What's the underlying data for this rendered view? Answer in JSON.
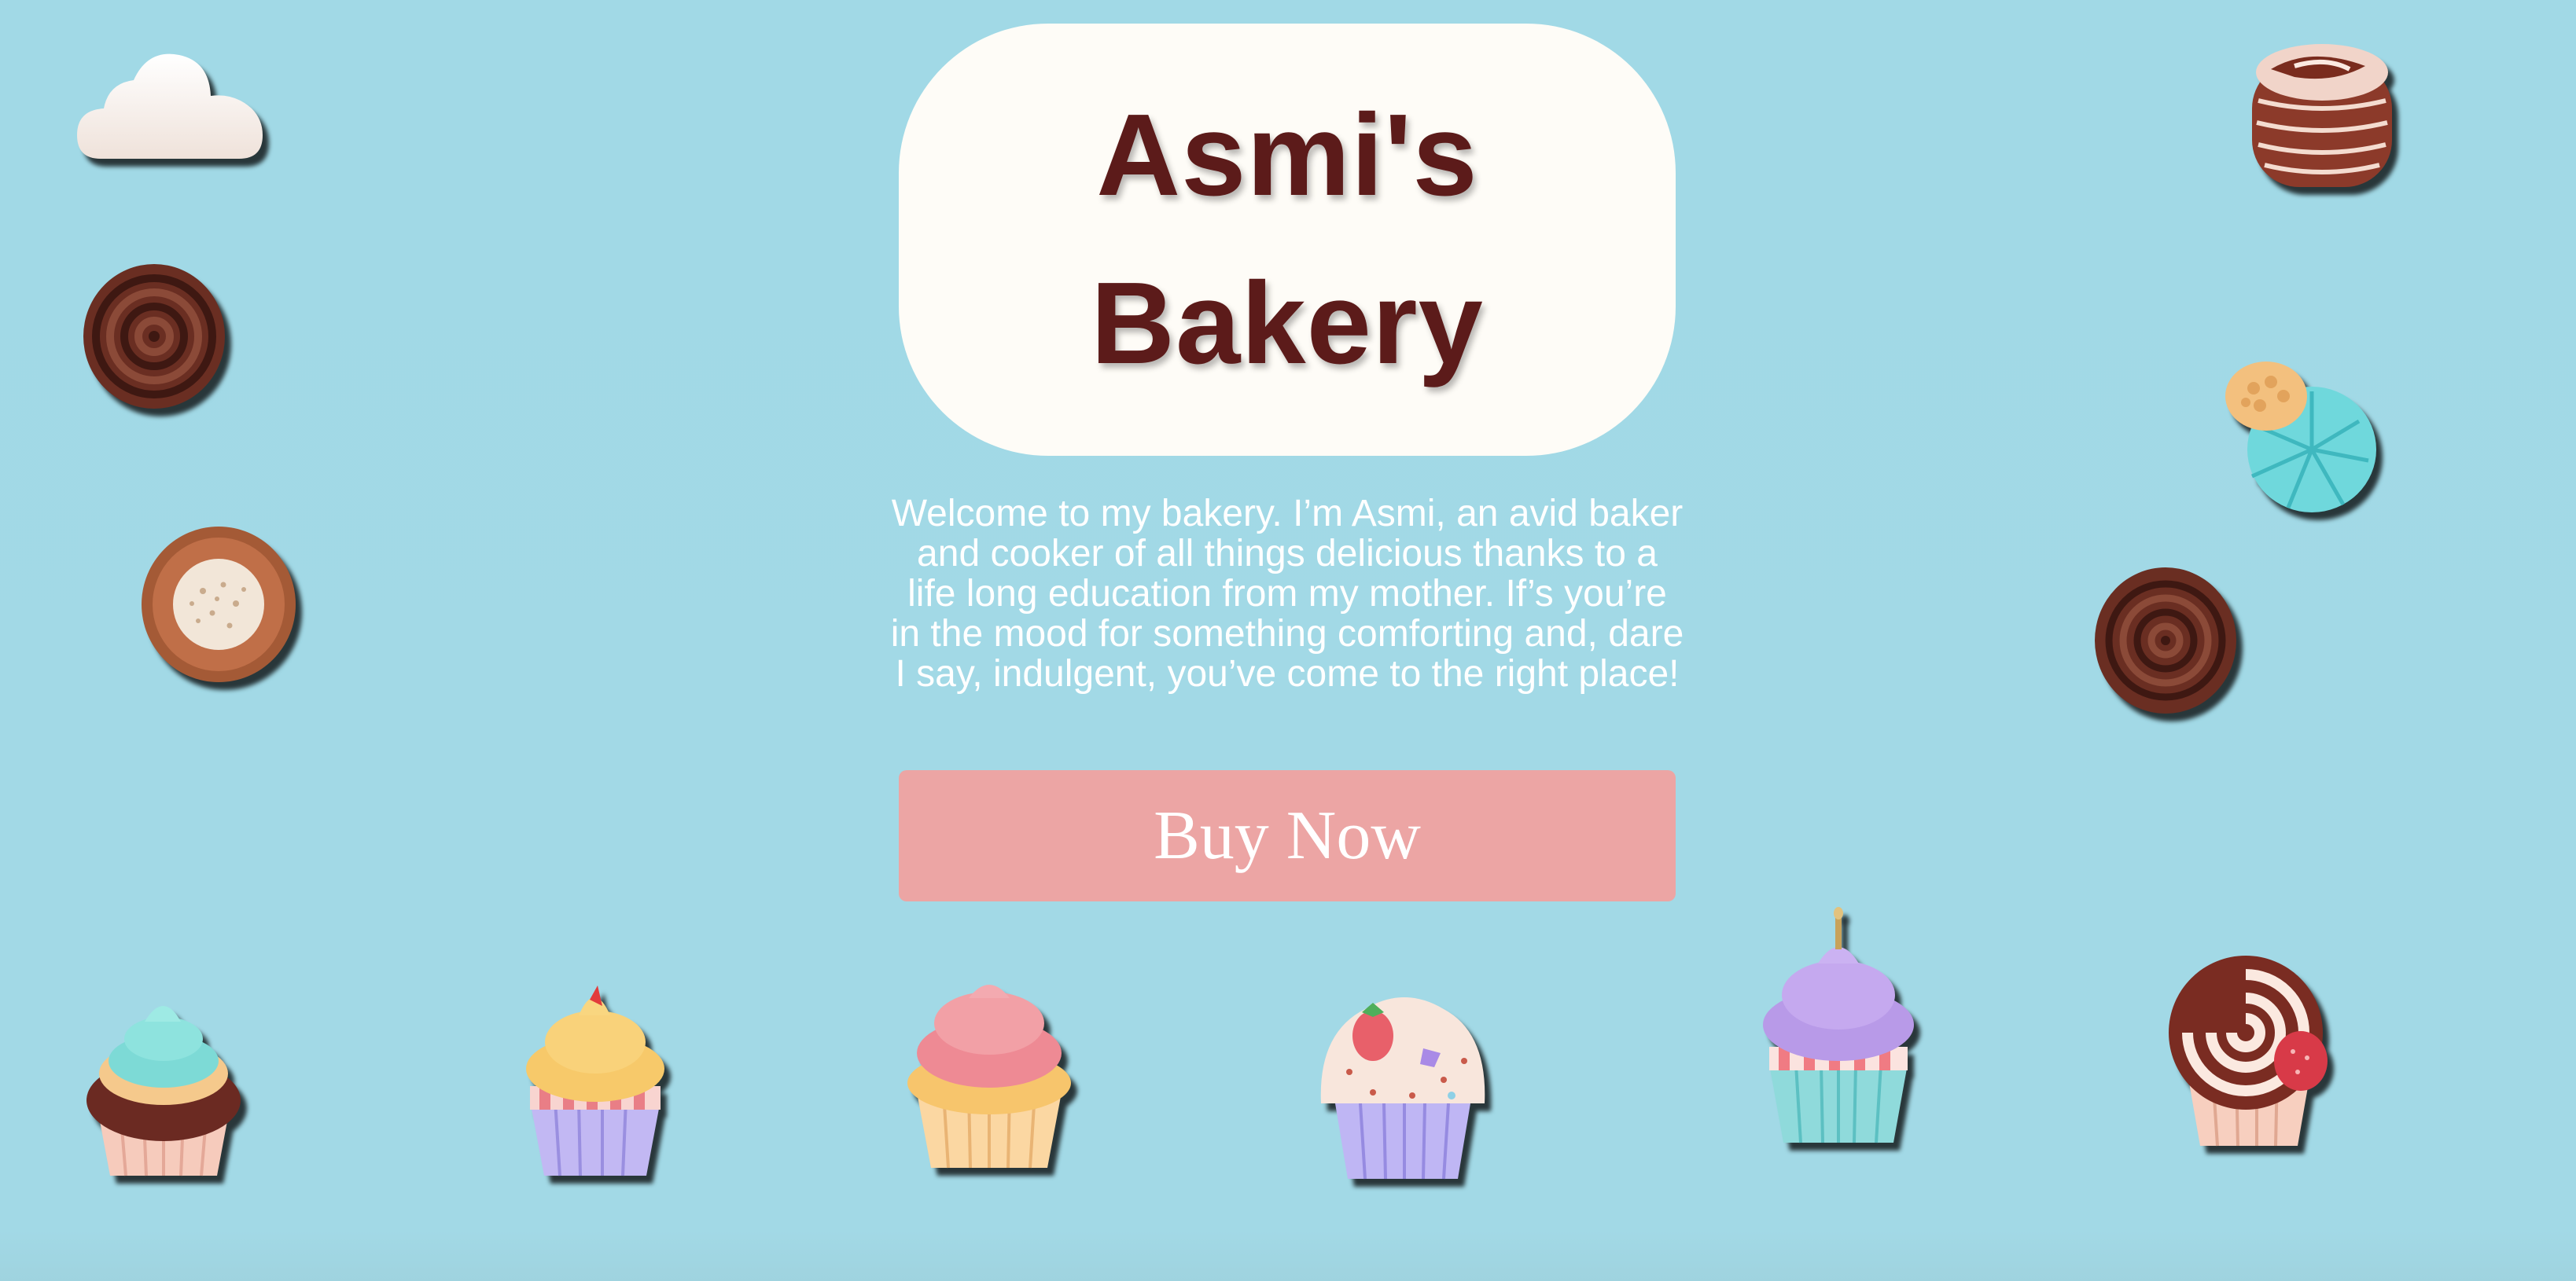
{
  "title": {
    "line1": "Asmi's",
    "line2": "Bakery"
  },
  "intro": {
    "text": "Welcome to my bakery. I’m Asmi, an avid baker and cooker of all things delicious thanks to a life long education from my mother. If’s you’re in the mood for something comforting and, dare I say, indulgent, you’ve come to the right place!"
  },
  "cta": {
    "label": "Buy Now"
  },
  "colors": {
    "background": "#a2d9e6",
    "title_card": "#fefcf7",
    "title_text": "#5c1b1a",
    "button": "#eca5a4",
    "button_text": "#ffffff",
    "body_text": "#ffffff"
  },
  "decorations": [
    "cloud-icon",
    "chocolate-swirl-icon",
    "cookie-icon",
    "chocolate-layer-cake-icon",
    "blue-pastry-icon",
    "chocolate-swirl-icon",
    "teal-cupcake-icon",
    "yellow-cupcake-icon",
    "pink-cupcake-icon",
    "strawberry-cupcake-icon",
    "lavender-cupcake-icon",
    "swirl-cupcake-icon"
  ]
}
